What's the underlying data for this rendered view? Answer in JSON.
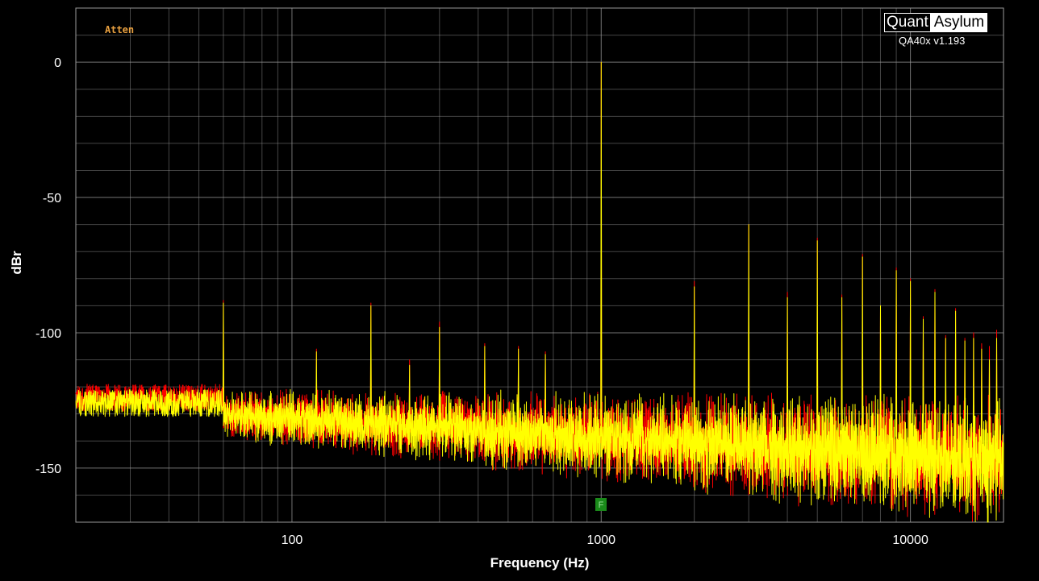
{
  "brand": {
    "name_left": "Quant",
    "name_right": "Asylum",
    "version": "QA40x v1.193"
  },
  "annotation": {
    "atten": "Atten",
    "marker_label": "F"
  },
  "colors": {
    "background": "#000000",
    "grid": "#9a9a9a",
    "trace_left": "#ff0000",
    "trace_right": "#ffff00",
    "marker": "#1a8a1a",
    "atten": "#e8a040"
  },
  "chart_data": {
    "type": "line",
    "title": "",
    "xlabel": "Frequency (Hz)",
    "ylabel": "dBr",
    "x_scale": "log",
    "xlim": [
      20,
      20000
    ],
    "ylim": [
      -170,
      20
    ],
    "x_ticks": [
      {
        "value": 100,
        "label": "100"
      },
      {
        "value": 1000,
        "label": "1000"
      },
      {
        "value": 10000,
        "label": "10000"
      }
    ],
    "y_ticks": [
      {
        "value": 0,
        "label": "0"
      },
      {
        "value": -50,
        "label": "-50"
      },
      {
        "value": -100,
        "label": "-100"
      },
      {
        "value": -150,
        "label": "-150"
      }
    ],
    "grid": true,
    "noise_floor_db": {
      "low": -158,
      "mid": -138,
      "high": -125
    },
    "series": [
      {
        "color": "#ff0000",
        "spurs": [
          [
            60,
            -88
          ],
          [
            120,
            -106
          ],
          [
            180,
            -89
          ],
          [
            240,
            -110
          ],
          [
            300,
            -96
          ],
          [
            420,
            -104
          ],
          [
            540,
            -105
          ],
          [
            660,
            -107
          ],
          [
            1000,
            0
          ],
          [
            2000,
            -81
          ],
          [
            3000,
            -60
          ],
          [
            4000,
            -85
          ],
          [
            5000,
            -65
          ],
          [
            6000,
            -86
          ],
          [
            7000,
            -71
          ],
          [
            8000,
            -90
          ],
          [
            9000,
            -76
          ],
          [
            10000,
            -80
          ],
          [
            11000,
            -94
          ],
          [
            12000,
            -84
          ],
          [
            13000,
            -101
          ],
          [
            14000,
            -91
          ],
          [
            15000,
            -102
          ],
          [
            16000,
            -100
          ],
          [
            17000,
            -104
          ],
          [
            18000,
            -105
          ],
          [
            19000,
            -99
          ]
        ]
      },
      {
        "color": "#ffff00",
        "spurs": [
          [
            60,
            -89
          ],
          [
            120,
            -107
          ],
          [
            180,
            -90
          ],
          [
            240,
            -112
          ],
          [
            300,
            -98
          ],
          [
            420,
            -105
          ],
          [
            540,
            -106
          ],
          [
            660,
            -108
          ],
          [
            1000,
            0
          ],
          [
            2000,
            -83
          ],
          [
            3000,
            -60
          ],
          [
            4000,
            -87
          ],
          [
            5000,
            -66
          ],
          [
            6000,
            -87
          ],
          [
            7000,
            -72
          ],
          [
            8000,
            -90
          ],
          [
            9000,
            -77
          ],
          [
            10000,
            -81
          ],
          [
            11000,
            -95
          ],
          [
            12000,
            -85
          ],
          [
            13000,
            -102
          ],
          [
            14000,
            -92
          ],
          [
            15000,
            -103
          ],
          [
            16000,
            -102
          ],
          [
            17000,
            -106
          ],
          [
            18000,
            -110
          ],
          [
            19000,
            -102
          ]
        ]
      }
    ]
  }
}
